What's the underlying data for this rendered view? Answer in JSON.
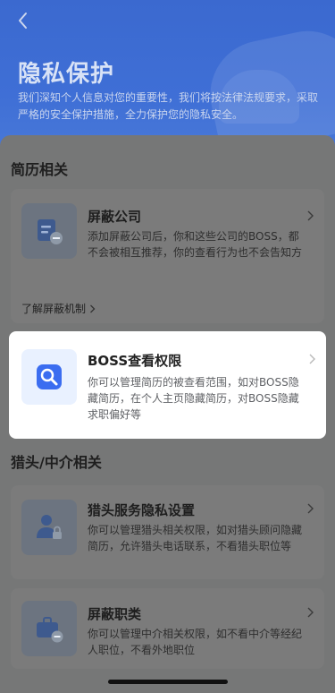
{
  "header": {
    "title": "隐私保护",
    "description": "我们深知个人信息对您的重要性，我们将按法律法规要求，采取严格的安全保护措施，全力保护您的隐私安全。"
  },
  "sections": {
    "resume": {
      "title": "简历相关",
      "items": [
        {
          "title": "屏蔽公司",
          "desc": "添加屏蔽公司后，你和这些公司的BOSS，都不会被相互推荐，你的查看行为也不会告知方",
          "link": "了解屏蔽机制",
          "icon": "shield-document-icon"
        },
        {
          "title": "BOSS查看权限",
          "desc": "你可以管理简历的被查看范围，如对BOSS隐藏简历，在个人主页隐藏简历，对BOSS隐藏求职偏好等",
          "icon": "magnifier-icon"
        }
      ]
    },
    "headhunter": {
      "title": "猎头/中介相关",
      "items": [
        {
          "title": "猎头服务隐私设置",
          "desc": "你可以管理猎头相关权限，如对猎头顾问隐藏简历，允许猎头电话联系，不看猎头职位等",
          "icon": "person-lock-icon"
        },
        {
          "title": "屏蔽职类",
          "desc": "你可以管理中介相关权限，如不看中介等经纪人职位，不看外地职位",
          "icon": "briefcase-block-icon"
        }
      ]
    }
  },
  "colors": {
    "header_blue": "#3f6fd6",
    "accent_blue": "#3b6df0",
    "overlay_gray": "#767777"
  }
}
